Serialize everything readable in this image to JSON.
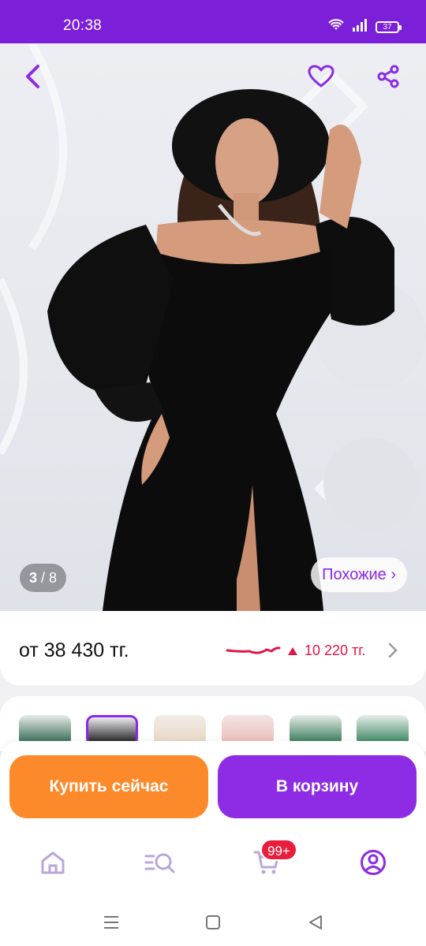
{
  "status": {
    "time": "20:38",
    "battery": "37"
  },
  "gallery": {
    "current": "3",
    "total": "/ 8",
    "similar_label": "Похожие ›"
  },
  "price": {
    "main": "от 38 430 тг.",
    "delta": "10 220 тг.",
    "delta_direction": "up",
    "accent": "#e1154a"
  },
  "variants": {
    "count": 6,
    "selected_index": 1,
    "colors": [
      "#1f5a44",
      "#141414",
      "#e8d6c2",
      "#e9b9b4",
      "#1f6d46",
      "#237a4f"
    ]
  },
  "actions": {
    "buy_now": "Купить сейчас",
    "add_to_cart": "В корзину",
    "buy_color": "#fd8a2a",
    "cart_color": "#8e2be4"
  },
  "tabbar": {
    "icons": [
      "home-icon",
      "catalog-search-icon",
      "cart-icon",
      "profile-icon"
    ],
    "cart_badge": "99+"
  },
  "brand": {
    "primary": "#7b1fd8"
  }
}
